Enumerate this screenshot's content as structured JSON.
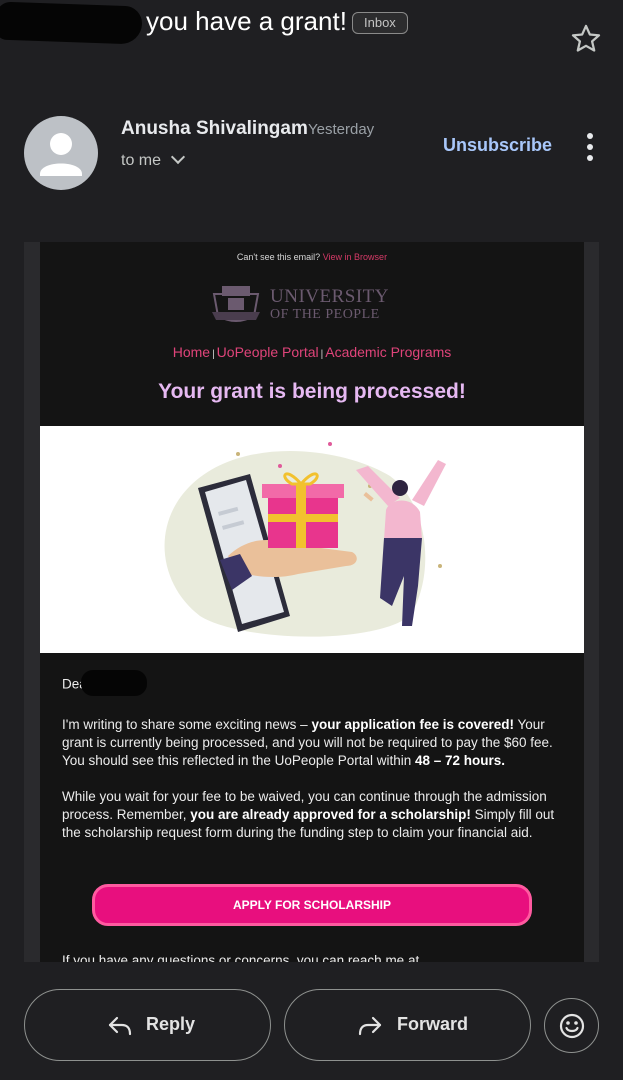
{
  "header": {
    "subject": "you have a grant!",
    "label": "Inbox"
  },
  "message": {
    "sender_name": "Anusha Shivalingam",
    "time": "Yesterday",
    "recipient": "to me",
    "unsubscribe": "Unsubscribe"
  },
  "email": {
    "preheader": "Can't see this email?",
    "view_in_browser": "View in Browser",
    "logo_line1": "UNIVERSITY",
    "logo_line2": "OF THE PEOPLE",
    "nav": [
      "Home",
      "UoPeople Portal",
      "Academic Programs"
    ],
    "headline": "Your grant is being processed!",
    "greeting": "Dea",
    "p1_a": "I'm writing to share some exciting news – ",
    "p1_b": "your application fee is covered!",
    "p1_c": " Your grant is currently being processed, and you will not be required to pay the $60 fee. You should see this reflected in the UoPeople Portal within ",
    "p1_d": "48 – 72 hours.",
    "p2_a": "While you wait for your fee to be waived, you can continue through the admission process. Remember, ",
    "p2_b": "you are already approved for a scholarship!",
    "p2_c": " Simply fill out the scholarship request form during the funding step to claim your financial aid.",
    "cta": "APPLY FOR SCHOLARSHIP",
    "cutoff": "If you have any questions or concerns, you can reach me at"
  },
  "actions": {
    "reply": "Reply",
    "forward": "Forward"
  },
  "colors": {
    "accent_pink": "#e80f7e",
    "headline_lilac": "#e6b9f2",
    "link_blue": "#a8c7fa"
  },
  "icons": [
    "star-icon",
    "more-vert-icon",
    "chevron-down-icon",
    "reply-icon",
    "forward-icon",
    "emoji-icon"
  ]
}
